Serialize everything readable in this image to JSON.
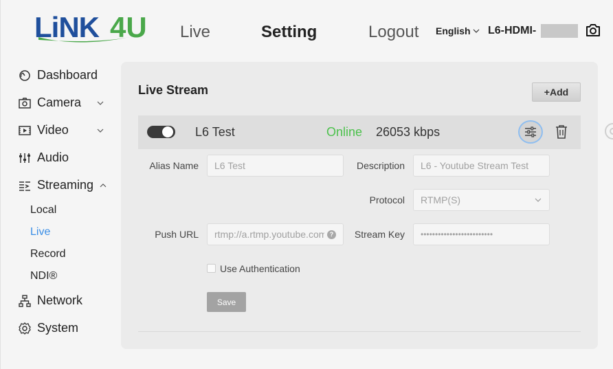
{
  "header": {
    "logo_text": "LiNK4U",
    "nav": {
      "live": "Live",
      "setting": "Setting",
      "logout": "Logout"
    },
    "language": "English",
    "device_name": "L6-HDMI-"
  },
  "sidebar": {
    "items": [
      {
        "label": "Dashboard",
        "icon": "dashboard-icon"
      },
      {
        "label": "Camera",
        "icon": "camera-icon"
      },
      {
        "label": "Video",
        "icon": "video-icon"
      },
      {
        "label": "Audio",
        "icon": "audio-icon"
      },
      {
        "label": "Streaming",
        "icon": "streaming-icon"
      },
      {
        "label": "Network",
        "icon": "network-icon"
      },
      {
        "label": "System",
        "icon": "system-icon"
      }
    ],
    "streaming_sub": [
      {
        "label": "Local"
      },
      {
        "label": "Live",
        "active": true
      },
      {
        "label": "Record"
      },
      {
        "label": "NDI®"
      }
    ]
  },
  "panel": {
    "title": "Live Stream",
    "add_label": "+Add",
    "stream": {
      "name": "L6 Test",
      "status": "Online",
      "bitrate": "26053 kbps",
      "enabled": true
    },
    "form": {
      "alias_label": "Alias Name",
      "alias_value": "L6 Test",
      "description_label": "Description",
      "description_value": "L6 - Youtube Stream Test",
      "protocol_label": "Protocol",
      "protocol_value": "RTMP(S)",
      "push_url_label": "Push URL",
      "push_url_value": "rtmp://a.rtmp.youtube.com",
      "stream_key_label": "Stream Key",
      "stream_key_value": "•••••••••••••••••••••••••",
      "use_auth_label": "Use Authentication",
      "save_label": "Save"
    }
  },
  "colors": {
    "online": "#4cc14c",
    "active_link": "#3a8ee6",
    "logo_blue": "#1f4f9c",
    "logo_green": "#4aa84a"
  }
}
